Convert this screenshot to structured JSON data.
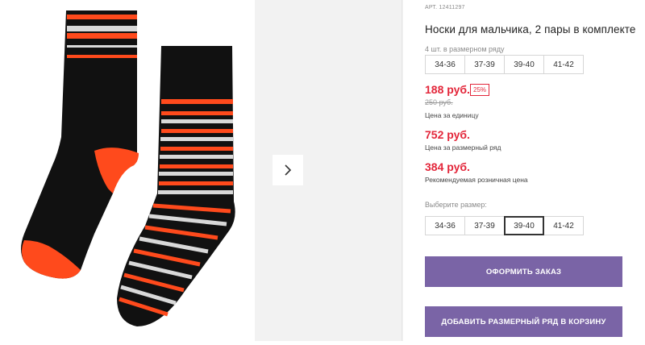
{
  "product": {
    "article": "АРТ. 12411297",
    "title": "Носки для мальчика, 2 пары в комплекте",
    "pack_info": "4 шт. в размерном ряду",
    "pack_sizes": [
      "34-36",
      "37-39",
      "39-40",
      "41-42"
    ]
  },
  "prices": {
    "unit_price": "188 руб.",
    "discount_badge": "25%",
    "old_price": "250 руб.",
    "unit_caption": "Цена за единицу",
    "row_price": "752 руб.",
    "row_caption": "Цена за размерный ряд",
    "retail_price": "384 руб.",
    "retail_caption": "Рекомендуемая розничная цена"
  },
  "size_select": {
    "label": "Выберите размер:",
    "options": [
      "34-36",
      "37-39",
      "39-40",
      "41-42"
    ],
    "selected": "39-40"
  },
  "actions": {
    "order_label": "ОФОРМИТЬ ЗАКАЗ",
    "add_row_label": "ДОБАВИТЬ РАЗМЕРНЫЙ РЯД В КОРЗИНУ"
  },
  "colors": {
    "accent": "#7a64a6",
    "sale_red": "#e3263a",
    "sock_black": "#111111",
    "sock_orange": "#ff4a1c",
    "sock_white": "#d9d9d9"
  },
  "icons": {
    "gallery_next": "chevron-right-icon"
  }
}
